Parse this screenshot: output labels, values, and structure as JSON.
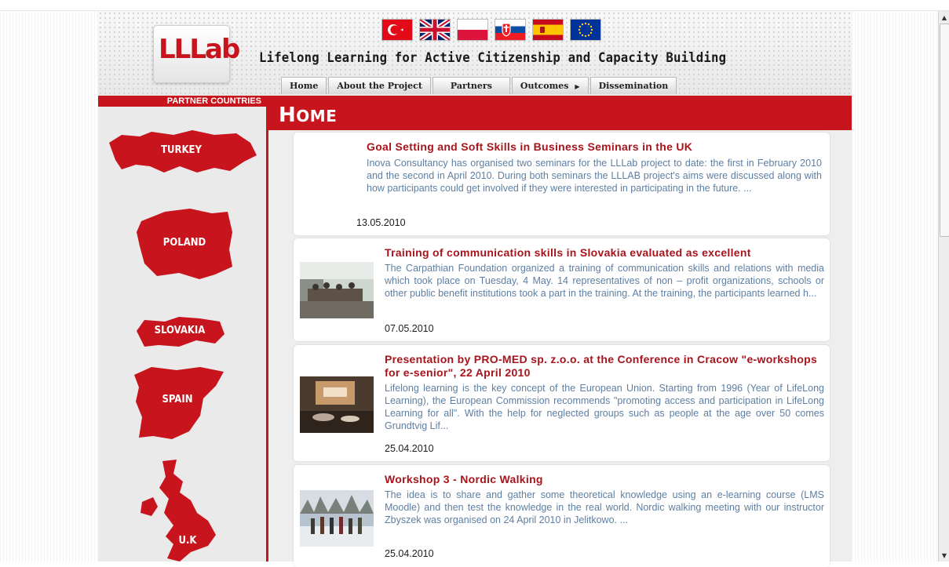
{
  "colors": {
    "accent": "#c8141c",
    "title_red": "#a8141c",
    "body_text": "#5e7fa3"
  },
  "header": {
    "logo_text": "LLLab",
    "title": "Lifelong Learning for Active Citizenship and Capacity Building",
    "flags": [
      "turkey-flag",
      "uk-flag",
      "poland-flag",
      "slovakia-flag",
      "spain-flag",
      "eu-flag"
    ]
  },
  "nav": {
    "tabs": [
      "Home",
      "About the Project",
      "Partners",
      "Outcomes",
      "Dissemination"
    ]
  },
  "sidebar": {
    "heading": "PARTNER COUNTRIES",
    "countries": [
      "TURKEY",
      "POLAND",
      "SLOVAKIA",
      "SPAIN",
      "U.K"
    ]
  },
  "page": {
    "title_first": "H",
    "title_rest": "OME"
  },
  "articles": [
    {
      "title": "Goal Setting and Soft Skills in Business Seminars in the UK",
      "text": "Inova Consultancy has organised two seminars for the LLLab project to date: the first in February 2010 and the second in April 2010. During both seminars the LLLAB project's aims were discussed along with how participants could get involved if they were interested in participating in the future. ...",
      "date": "13.05.2010"
    },
    {
      "title": "Training of communication skills in Slovakia evaluated as excellent",
      "text": "The Carpathian Foundation organized a training of communication skills and relations with media which took place on Tuesday, 4 May. 14 representatives of non – profit organizations, schools or other public benefit institutions took a part in the training. At the training, the participants learned h...",
      "date": "07.05.2010"
    },
    {
      "title": "Presentation by PRO-MED sp. z.o.o. at the Conference in Cracow \"e-workshops for e-senior\", 22 April 2010",
      "text": "Lifelong learning is the key concept of the European Union. Starting from 1996 (Year of LifeLong Learning), the European Commission recommends \"promoting access and participation in LifeLong Learning for all\". With the help for neglected groups such as people at the age over 50 comes Grundtvig Lif...",
      "date": "25.04.2010"
    },
    {
      "title": "Workshop 3 - Nordic Walking",
      "text": "The idea is to share and gather some theoretical knowledge using an e-learning course (LMS Moodle) and then test the knowledge in the real world. Nordic walking meeting with our instructor Zbyszek was organised on 24 April 2010 in Jelitkowo. ...",
      "date": "25.04.2010"
    }
  ]
}
